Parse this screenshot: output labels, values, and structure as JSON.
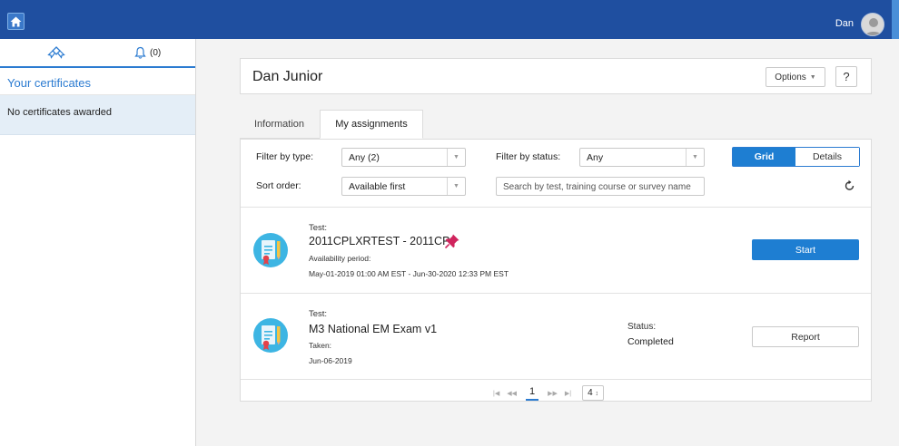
{
  "topbar": {
    "home_icon": "home-icon",
    "user_name": "Dan",
    "avatar_icon": "user-avatar-icon",
    "brand_color": "#1f4fa0"
  },
  "sidebar": {
    "tab_certificates_icon": "certificate-ribbon-icon",
    "tab_notifications_icon": "bell-icon",
    "notifications_count": "(0)",
    "section_title": "Your certificates",
    "empty_text": "No certificates awarded"
  },
  "header": {
    "title": "Dan Junior",
    "options_label": "Options",
    "help_label": "?"
  },
  "tabs": [
    {
      "label": "Information",
      "active": false
    },
    {
      "label": "My assignments",
      "active": true
    }
  ],
  "filters": {
    "type_label": "Filter by type:",
    "type_value": "Any (2)",
    "status_label": "Filter by status:",
    "status_value": "Any",
    "sort_label": "Sort order:",
    "sort_value": "Available first",
    "search_placeholder": "Search by test, training course or survey name",
    "view_grid": "Grid",
    "view_details": "Details",
    "refresh_icon": "refresh-icon"
  },
  "assignments": [
    {
      "type_label": "Test:",
      "title": "2011CPLXRTEST - 2011CP",
      "pinned": true,
      "period_label": "Availability period:",
      "period_value": "May-01-2019 01:00 AM EST - Jun-30-2020 12:33 PM EST",
      "action_label": "Start"
    },
    {
      "type_label": "Test:",
      "title": "M3 National EM Exam v1",
      "taken_label": "Taken:",
      "taken_value": "Jun-06-2019",
      "status_label": "Status:",
      "status_value": "Completed",
      "action_label": "Report"
    }
  ],
  "pagination": {
    "current_page": "1",
    "page_size": "4"
  },
  "colors": {
    "accent": "#1e7ed2",
    "sidebar_selected": "#e4eef7",
    "pin": "#d0245d"
  }
}
